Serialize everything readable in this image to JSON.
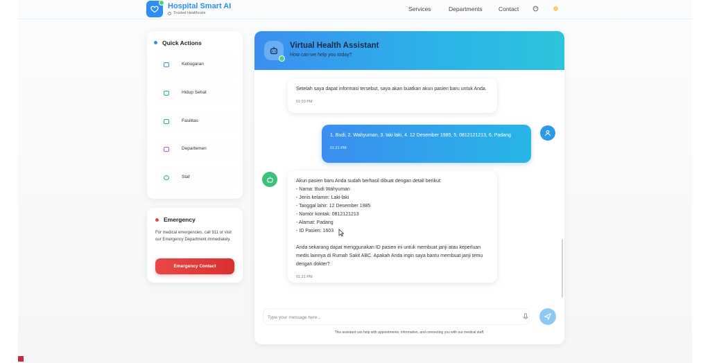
{
  "brand": {
    "title": "Hospital Smart AI",
    "subtitle": "Trusted Healthcare"
  },
  "nav": {
    "links": [
      "Services",
      "Departments",
      "Contact"
    ]
  },
  "quick_actions": {
    "title": "Quick Actions",
    "items": [
      {
        "label": "Kebugaran",
        "icon": "monitor-icon",
        "color": "#3b8ee8"
      },
      {
        "label": "Hidup Sehat",
        "icon": "heart-icon",
        "color": "#33b36b"
      },
      {
        "label": "Fasilitas",
        "icon": "bed-icon",
        "color": "#33b36b"
      },
      {
        "label": "Departemen",
        "icon": "building-icon",
        "color": "#a765e0"
      },
      {
        "label": "Staf",
        "icon": "users-icon",
        "color": "#33b36b"
      }
    ]
  },
  "emergency": {
    "title": "Emergency",
    "text": "For medical emergencies, call 911 or visit our Emergency Department immediately.",
    "button": "Emergency Contact"
  },
  "chat": {
    "title": "Virtual Health Assistant",
    "subtitle": "How can we help you today?",
    "messages": [
      {
        "role": "assistant",
        "text": "Setelah saya dapat informasi tersebut, saya akan buatkan akun pasien baru untuk Anda.",
        "time": "01:20 PM"
      },
      {
        "role": "user",
        "text": "1. Budi, 2. Wahyuman, 3. laki laki, 4. 12 Desember 1985, 5. 0812121213, 6. Padang",
        "time": "01:21 PM"
      },
      {
        "role": "assistant",
        "lines": [
          "Akun pasien baru Anda sudah berhasil dibuat dengan detail berikut:",
          "- Nama: Budi Wahyuman",
          "- Jenis kelamin: Laki-laki",
          "- Tanggal lahir: 12 Desember 1985",
          "- Nomor kontak: 0812121213",
          "- Alamat: Padang",
          "- ID Pasien: 1603",
          "",
          "Anda sekarang dapat menggunakan ID pasien ini untuk membuat janji atau keperluan medis lainnya di Rumah Sakit ABC. Apakah Anda ingin saya bantu membuat janji temu dengan dokter?"
        ],
        "time": "01:21 PM"
      }
    ],
    "input_placeholder": "Type your message here...",
    "disclaimer": "This assistant can help with appointments, information, and connecting you with our medical staff."
  },
  "colors": {
    "primary": "#2f8ef5",
    "gradient_end": "#2cc4dc",
    "emergency": "#e84545",
    "online": "#4cd37a"
  }
}
